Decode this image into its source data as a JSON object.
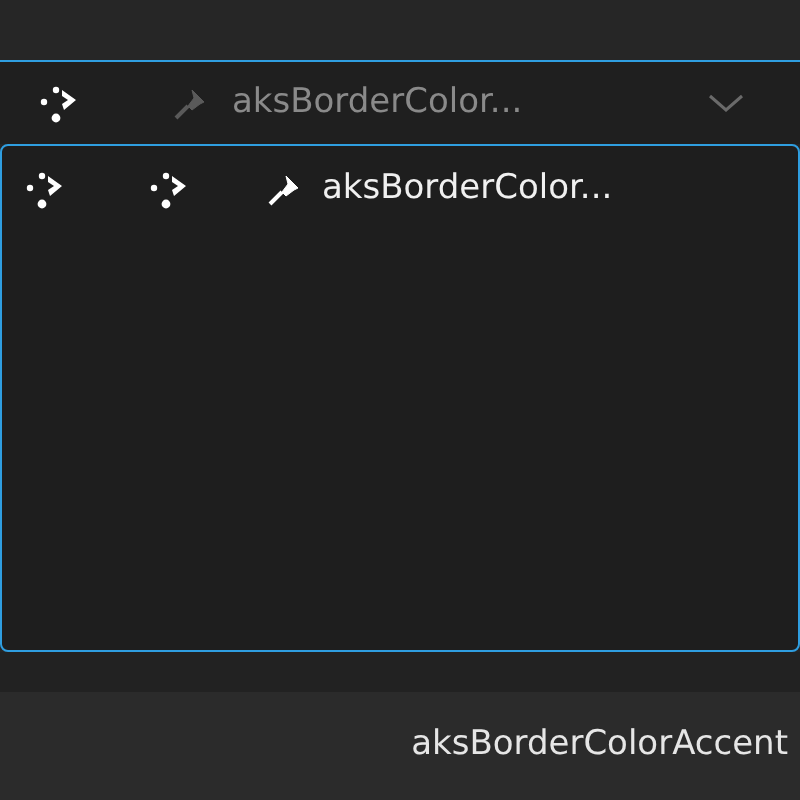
{
  "dropdown": {
    "label": "aksBorderColor...",
    "expanded": true
  },
  "options": [
    {
      "label": "aksBorderColor...",
      "selected": true
    }
  ],
  "footer": {
    "value": "aksBorderColorAccent"
  }
}
